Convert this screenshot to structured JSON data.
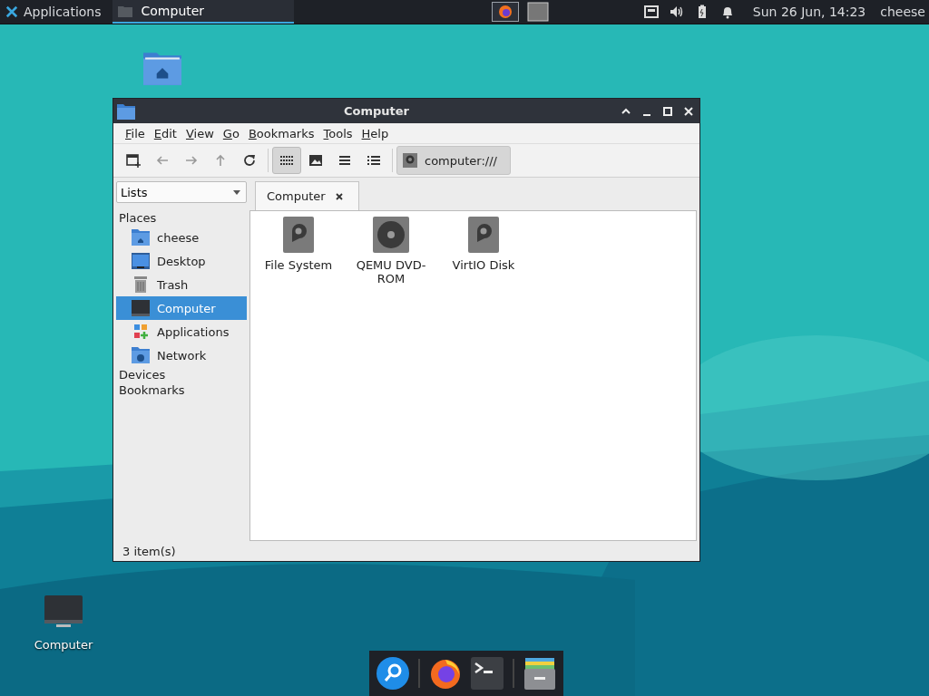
{
  "panel": {
    "applications": "Applications",
    "tasks": [
      {
        "label": "Computer",
        "selected": true
      }
    ],
    "clock": "Sun 26 Jun, 14:23",
    "user": "cheese"
  },
  "desktop_icons": [
    {
      "kind": "home-folder"
    },
    {
      "kind": "computer",
      "label": "Computer"
    }
  ],
  "window": {
    "title": "Computer",
    "menu": [
      "File",
      "Edit",
      "View",
      "Go",
      "Bookmarks",
      "Tools",
      "Help"
    ],
    "view_modes": [
      {
        "kind": "icons",
        "selected": true
      },
      {
        "kind": "thumbnails",
        "selected": false
      },
      {
        "kind": "compact",
        "selected": false
      },
      {
        "kind": "details",
        "selected": false
      }
    ],
    "location": "computer:///",
    "side_pane": {
      "mode": "Lists",
      "sections": [
        {
          "label": "Places",
          "items": [
            {
              "kind": "home",
              "label": "cheese",
              "selected": false
            },
            {
              "kind": "desktop",
              "label": "Desktop",
              "selected": false
            },
            {
              "kind": "trash",
              "label": "Trash",
              "selected": false
            },
            {
              "kind": "computer",
              "label": "Computer",
              "selected": true
            },
            {
              "kind": "applications",
              "label": "Applications",
              "selected": false
            },
            {
              "kind": "network",
              "label": "Network",
              "selected": false
            }
          ]
        },
        {
          "label": "Devices"
        },
        {
          "label": "Bookmarks"
        }
      ]
    },
    "tabs": [
      {
        "label": "Computer",
        "selected": true
      }
    ],
    "files": [
      {
        "kind": "drive",
        "name": "File System"
      },
      {
        "kind": "optical",
        "name": "QEMU DVD-ROM"
      },
      {
        "kind": "drive",
        "name": "VirtIO Disk"
      }
    ],
    "status": "3 item(s)"
  },
  "dock": [
    {
      "kind": "search"
    },
    {
      "kind": "browser"
    },
    {
      "kind": "terminal"
    },
    {
      "kind": "files"
    }
  ]
}
